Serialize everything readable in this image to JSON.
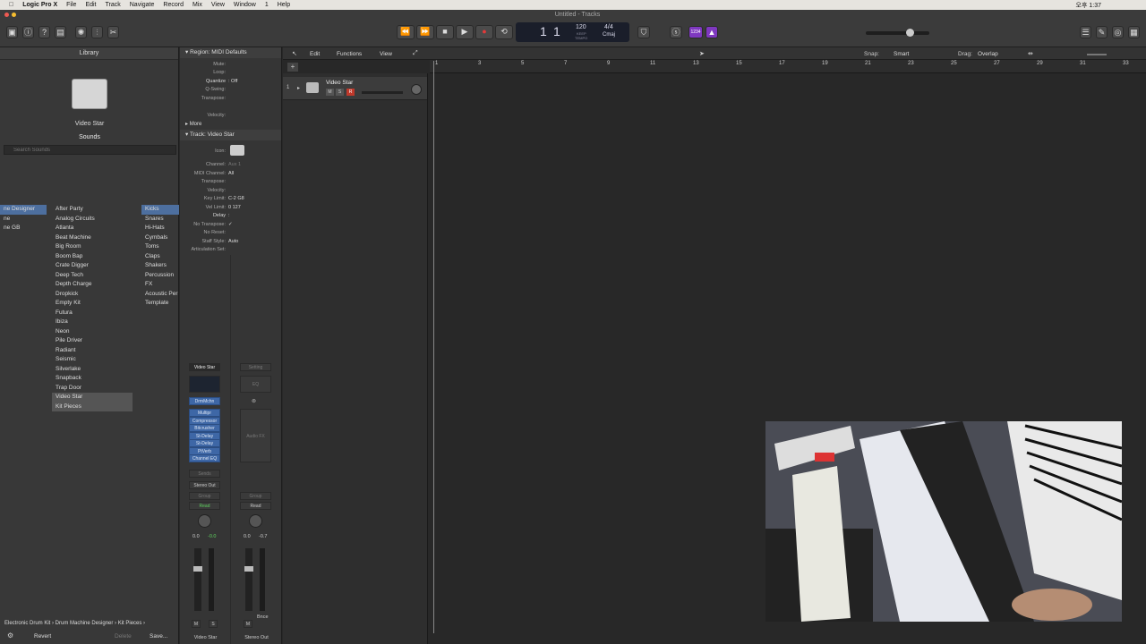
{
  "menubar": {
    "items": [
      "Logic Pro X",
      "File",
      "Edit",
      "Track",
      "Navigate",
      "Record",
      "Mix",
      "View",
      "Window",
      "1",
      "Help"
    ],
    "clock": "오후 1:37"
  },
  "window_title": "Untitled - Tracks",
  "lcd": {
    "bar": "1",
    "beat": "1",
    "tempo": "120",
    "keep": "KEEP",
    "tempo_label": "TEMPO",
    "sig": "4/4",
    "key": "Cmaj",
    "midi_label": "1234"
  },
  "library": {
    "title": "Library",
    "patch_name": "Video Star",
    "sounds_label": "Sounds",
    "search_placeholder": "Search Sounds",
    "col1": [
      "ne Designer",
      "ne",
      "ne GB"
    ],
    "col2": [
      "After Party",
      "Analog Circuits",
      "Atlanta",
      "Beat Machine",
      "Big Room",
      "Boom Bap",
      "Crate Digger",
      "Deep Tech",
      "Depth Charge",
      "Dropkick",
      "Empty Kit",
      "Futura",
      "Ibiza",
      "Neon",
      "Pile Driver",
      "Radiant",
      "Seismic",
      "Silverlake",
      "Snapback",
      "Trap Door",
      "Video Star",
      "Kit Pieces"
    ],
    "col3": [
      "Kicks",
      "Snares",
      "Hi-Hats",
      "Cymbals",
      "Toms",
      "Claps",
      "Shakers",
      "Percussion",
      "FX",
      "Acoustic Per",
      "Template"
    ],
    "path": "Electronic Drum Kit › Drum Machine Designer › Kit Pieces ›",
    "revert": "Revert",
    "delete": "Delete",
    "save": "Save..."
  },
  "inspector": {
    "region_title": "Region: MIDI Defaults",
    "region_rows": [
      [
        "Mute:",
        ""
      ],
      [
        "Loop:",
        ""
      ],
      [
        "Quantize",
        ": Off"
      ],
      [
        "Q-Swing:",
        ""
      ],
      [
        "Transpose:",
        ""
      ],
      [
        "Velocity:",
        ""
      ]
    ],
    "more": "More",
    "track_title": "Track: Video Star",
    "icon_label": "Icon:",
    "track_rows": [
      [
        "Channel:",
        "Aux 1"
      ],
      [
        "MIDI Channel:",
        "All"
      ],
      [
        "Transpose:",
        ""
      ],
      [
        "Velocity:",
        ""
      ],
      [
        "Key Limit:",
        "C-2  G8"
      ],
      [
        "Vel Limit:",
        "0  127"
      ],
      [
        "Delay",
        ":"
      ],
      [
        "No Transpose:",
        "✓"
      ],
      [
        "No Reset:",
        ""
      ],
      [
        "Staff Style:",
        "Auto"
      ],
      [
        "Articulation Set:",
        ""
      ]
    ],
    "strip1": {
      "name": "Video Star",
      "instrument": "DrmMchn",
      "plugins": [
        "Multipr",
        "Compressor",
        "Bitcrusher",
        "St-Delay",
        "St-Delay",
        "PtVerb",
        "Channel EQ"
      ],
      "sends": "Sends",
      "output": "Stereo Out",
      "group": "Group",
      "auto": "Read",
      "vol": "0.0",
      "pk": "-0.0",
      "m": "M",
      "s": "S",
      "label": "Video Star"
    },
    "strip2": {
      "setting": "Setting",
      "eq": "EQ",
      "audiofx": "Audio FX",
      "group": "Group",
      "auto": "Read",
      "vol": "0.0",
      "pk": "-0.7",
      "m": "M",
      "bnce": "Bnce",
      "label": "Stereo Out"
    }
  },
  "tracks_toolbar": {
    "edit": "Edit",
    "functions": "Functions",
    "view": "View",
    "snap_label": "Snap:",
    "snap": "Smart",
    "drag_label": "Drag:",
    "drag": "Overlap"
  },
  "ruler": [
    "1",
    "3",
    "5",
    "7",
    "9",
    "11",
    "13",
    "15",
    "17",
    "19",
    "21",
    "23",
    "25",
    "27",
    "29",
    "31",
    "33"
  ],
  "track": {
    "number": "1",
    "name": "Video Star",
    "m": "M",
    "s": "S",
    "r": "R"
  }
}
